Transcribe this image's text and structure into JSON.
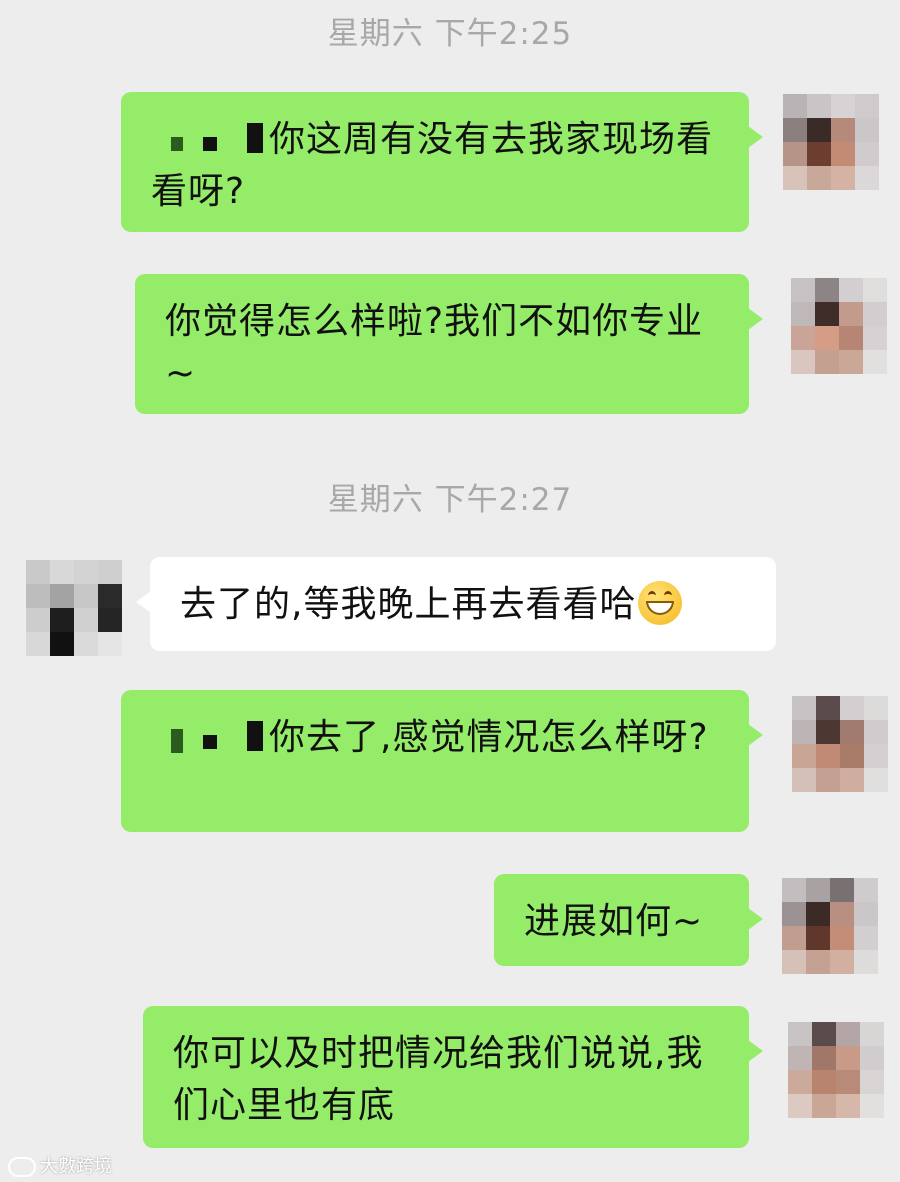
{
  "timestamps": [
    "星期六 下午2:25",
    "星期六 下午2:27"
  ],
  "messages": [
    {
      "side": "out",
      "redacted_prefix": true,
      "text": "你这周有没有去我家现场看看呀?"
    },
    {
      "side": "out",
      "redacted_prefix": false,
      "text": "你觉得怎么样啦?我们不如你专业~"
    },
    {
      "side": "in",
      "redacted_prefix": false,
      "text": "去了的,等我晚上再去看看哈",
      "emoji": "grin-emoji"
    },
    {
      "side": "out",
      "redacted_prefix": true,
      "text": "你去了,感觉情况怎么样呀?"
    },
    {
      "side": "out",
      "redacted_prefix": false,
      "text": "进展如何~"
    },
    {
      "side": "out",
      "redacted_prefix": false,
      "text": "你可以及时把情况给我们说说,我们心里也有底"
    }
  ],
  "colors": {
    "background": "#ededed",
    "outgoing_bubble": "#95ec69",
    "incoming_bubble": "#ffffff",
    "timestamp_text": "#a8a8a8"
  },
  "watermark": {
    "text": "大數跨境"
  }
}
